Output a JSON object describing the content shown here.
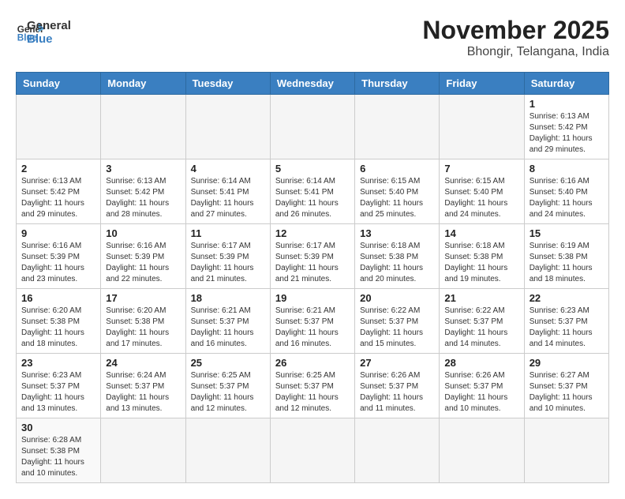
{
  "header": {
    "logo_general": "General",
    "logo_blue": "Blue",
    "title": "November 2025",
    "subtitle": "Bhongir, Telangana, India"
  },
  "days_of_week": [
    "Sunday",
    "Monday",
    "Tuesday",
    "Wednesday",
    "Thursday",
    "Friday",
    "Saturday"
  ],
  "weeks": [
    [
      {
        "day": "",
        "info": ""
      },
      {
        "day": "",
        "info": ""
      },
      {
        "day": "",
        "info": ""
      },
      {
        "day": "",
        "info": ""
      },
      {
        "day": "",
        "info": ""
      },
      {
        "day": "",
        "info": ""
      },
      {
        "day": "1",
        "info": "Sunrise: 6:13 AM\nSunset: 5:42 PM\nDaylight: 11 hours\nand 29 minutes."
      }
    ],
    [
      {
        "day": "2",
        "info": "Sunrise: 6:13 AM\nSunset: 5:42 PM\nDaylight: 11 hours\nand 29 minutes."
      },
      {
        "day": "3",
        "info": "Sunrise: 6:13 AM\nSunset: 5:42 PM\nDaylight: 11 hours\nand 28 minutes."
      },
      {
        "day": "4",
        "info": "Sunrise: 6:14 AM\nSunset: 5:41 PM\nDaylight: 11 hours\nand 27 minutes."
      },
      {
        "day": "5",
        "info": "Sunrise: 6:14 AM\nSunset: 5:41 PM\nDaylight: 11 hours\nand 26 minutes."
      },
      {
        "day": "6",
        "info": "Sunrise: 6:15 AM\nSunset: 5:40 PM\nDaylight: 11 hours\nand 25 minutes."
      },
      {
        "day": "7",
        "info": "Sunrise: 6:15 AM\nSunset: 5:40 PM\nDaylight: 11 hours\nand 24 minutes."
      },
      {
        "day": "8",
        "info": "Sunrise: 6:16 AM\nSunset: 5:40 PM\nDaylight: 11 hours\nand 24 minutes."
      }
    ],
    [
      {
        "day": "9",
        "info": "Sunrise: 6:16 AM\nSunset: 5:39 PM\nDaylight: 11 hours\nand 23 minutes."
      },
      {
        "day": "10",
        "info": "Sunrise: 6:16 AM\nSunset: 5:39 PM\nDaylight: 11 hours\nand 22 minutes."
      },
      {
        "day": "11",
        "info": "Sunrise: 6:17 AM\nSunset: 5:39 PM\nDaylight: 11 hours\nand 21 minutes."
      },
      {
        "day": "12",
        "info": "Sunrise: 6:17 AM\nSunset: 5:39 PM\nDaylight: 11 hours\nand 21 minutes."
      },
      {
        "day": "13",
        "info": "Sunrise: 6:18 AM\nSunset: 5:38 PM\nDaylight: 11 hours\nand 20 minutes."
      },
      {
        "day": "14",
        "info": "Sunrise: 6:18 AM\nSunset: 5:38 PM\nDaylight: 11 hours\nand 19 minutes."
      },
      {
        "day": "15",
        "info": "Sunrise: 6:19 AM\nSunset: 5:38 PM\nDaylight: 11 hours\nand 18 minutes."
      }
    ],
    [
      {
        "day": "16",
        "info": "Sunrise: 6:20 AM\nSunset: 5:38 PM\nDaylight: 11 hours\nand 18 minutes."
      },
      {
        "day": "17",
        "info": "Sunrise: 6:20 AM\nSunset: 5:38 PM\nDaylight: 11 hours\nand 17 minutes."
      },
      {
        "day": "18",
        "info": "Sunrise: 6:21 AM\nSunset: 5:37 PM\nDaylight: 11 hours\nand 16 minutes."
      },
      {
        "day": "19",
        "info": "Sunrise: 6:21 AM\nSunset: 5:37 PM\nDaylight: 11 hours\nand 16 minutes."
      },
      {
        "day": "20",
        "info": "Sunrise: 6:22 AM\nSunset: 5:37 PM\nDaylight: 11 hours\nand 15 minutes."
      },
      {
        "day": "21",
        "info": "Sunrise: 6:22 AM\nSunset: 5:37 PM\nDaylight: 11 hours\nand 14 minutes."
      },
      {
        "day": "22",
        "info": "Sunrise: 6:23 AM\nSunset: 5:37 PM\nDaylight: 11 hours\nand 14 minutes."
      }
    ],
    [
      {
        "day": "23",
        "info": "Sunrise: 6:23 AM\nSunset: 5:37 PM\nDaylight: 11 hours\nand 13 minutes."
      },
      {
        "day": "24",
        "info": "Sunrise: 6:24 AM\nSunset: 5:37 PM\nDaylight: 11 hours\nand 13 minutes."
      },
      {
        "day": "25",
        "info": "Sunrise: 6:25 AM\nSunset: 5:37 PM\nDaylight: 11 hours\nand 12 minutes."
      },
      {
        "day": "26",
        "info": "Sunrise: 6:25 AM\nSunset: 5:37 PM\nDaylight: 11 hours\nand 12 minutes."
      },
      {
        "day": "27",
        "info": "Sunrise: 6:26 AM\nSunset: 5:37 PM\nDaylight: 11 hours\nand 11 minutes."
      },
      {
        "day": "28",
        "info": "Sunrise: 6:26 AM\nSunset: 5:37 PM\nDaylight: 11 hours\nand 10 minutes."
      },
      {
        "day": "29",
        "info": "Sunrise: 6:27 AM\nSunset: 5:37 PM\nDaylight: 11 hours\nand 10 minutes."
      }
    ],
    [
      {
        "day": "30",
        "info": "Sunrise: 6:28 AM\nSunset: 5:38 PM\nDaylight: 11 hours\nand 10 minutes."
      },
      {
        "day": "",
        "info": ""
      },
      {
        "day": "",
        "info": ""
      },
      {
        "day": "",
        "info": ""
      },
      {
        "day": "",
        "info": ""
      },
      {
        "day": "",
        "info": ""
      },
      {
        "day": "",
        "info": ""
      }
    ]
  ]
}
